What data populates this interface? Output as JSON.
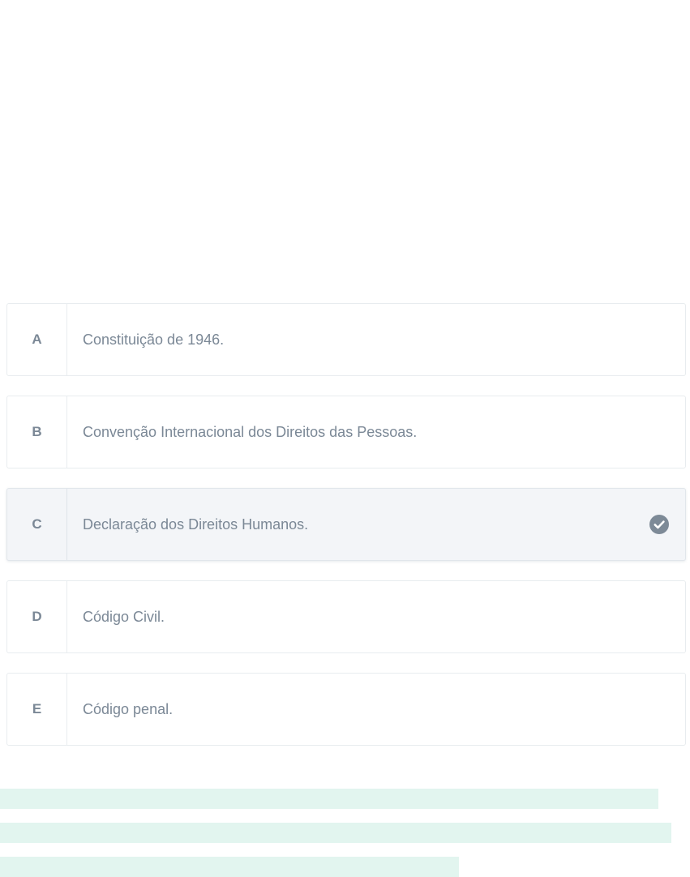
{
  "question": {
    "options": [
      {
        "letter": "A",
        "text": "Constituição de 1946.",
        "selected": false
      },
      {
        "letter": "B",
        "text": "Convenção Internacional dos Direitos das Pessoas.",
        "selected": false
      },
      {
        "letter": "C",
        "text": "Declaração dos Direitos Humanos.",
        "selected": true
      },
      {
        "letter": "D",
        "text": "Código Civil.",
        "selected": false
      },
      {
        "letter": "E",
        "text": "Código penal.",
        "selected": false
      }
    ],
    "selected_icon": "check-circle-icon"
  },
  "colors": {
    "text": "#7b8896",
    "selected_background": "#f3f5f8",
    "border": "#e8ecef",
    "check": "#7d8a97",
    "placeholder_bar": "#e2f5ef"
  }
}
